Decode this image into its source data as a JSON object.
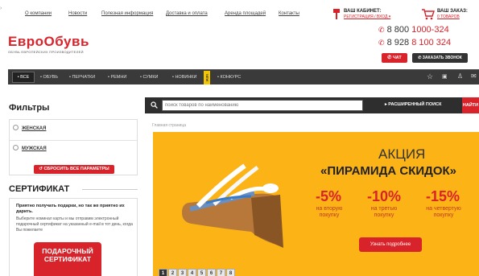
{
  "topnav": {
    "items": [
      "О компании",
      "Новости",
      "Полезная информация",
      "Доставка и оплата",
      "Аренда площадей",
      "Контакты"
    ]
  },
  "cabinet": {
    "title": "ВАШ КАБИНЕТ:",
    "links": "РЕГИСТРАЦИЯ / ВХОД ▾"
  },
  "cart": {
    "title": "ВАШ ЗАКАЗ:",
    "count": "0 ТОВАРОВ"
  },
  "logo": {
    "name": "ЕвроОбувь",
    "tagline": "ОБУВЬ ЕВРОПЕЙСКИХ ПРОИЗВОДИТЕЛЕЙ"
  },
  "phones": {
    "p1_prefix": "8 800 ",
    "p1_num": "1000-324",
    "p2_prefix": "8 928 ",
    "p2_num": "8 100 324"
  },
  "buttons": {
    "chat": "ЧАТ",
    "callback": "ЗАКАЗАТЬ ЗВОНОК"
  },
  "catnav": {
    "items": [
      "• ВСЕ",
      "• ОБУВЬ",
      "• ПЕРЧАТКИ",
      "• РЕМНИ",
      "• СУМКИ",
      "• НОВИНКИ",
      "• КОНКУРС"
    ],
    "badge": "NEW"
  },
  "filters": {
    "title": "Фильтры",
    "items": [
      "ЖЕНСКАЯ",
      "МУЖСКАЯ"
    ],
    "reset": "СБРОСИТЬ ВСЕ ПАРАМЕТРЫ"
  },
  "certificate": {
    "title": "СЕРТИФИКАТ",
    "lead": "Приятно получать подарки, но так же приятно их дарить.",
    "body": "Выберите номинал карты и мы отправим электронный подарочный сертификат на указанный e-mail в тот день, когда Вы пожелаете",
    "card_line1": "ПОДАРОЧНЫЙ",
    "card_line2": "СЕРТИФИКАТ"
  },
  "search": {
    "placeholder": "поиск товаров по наименованию",
    "advanced": "РАСШИРЕННЫЙ ПОИСК",
    "find": "НАЙТИ"
  },
  "breadcrumb": "Главная страница",
  "banner": {
    "line1": "АКЦИЯ",
    "line2": "«ПИРАМИДА СКИДОК»",
    "d1": "-5%",
    "l1": "на вторую покупку",
    "d2": "-10%",
    "l2": "на третью покупку",
    "d3": "-15%",
    "l3": "на четвертую покупку",
    "more": "Узнать подробнее",
    "pages": [
      "1",
      "2",
      "3",
      "4",
      "5",
      "6",
      "7",
      "8"
    ]
  },
  "colors": {
    "accent": "#d9232a",
    "banner": "#fcb316",
    "dark": "#3a3a3a"
  }
}
